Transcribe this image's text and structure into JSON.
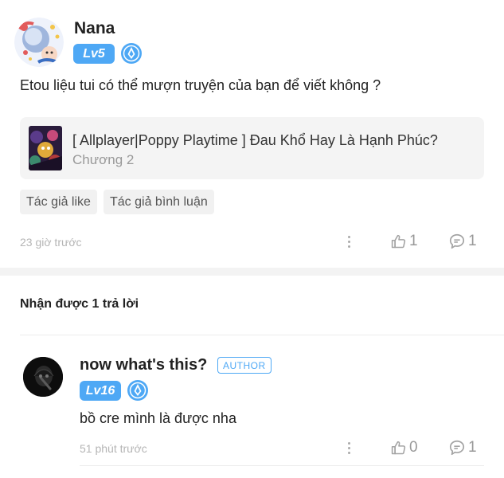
{
  "post": {
    "author_name": "Nana",
    "level": "Lv5",
    "comment": "Etou liệu tui có thể mượn truyện của bạn để viết không ?",
    "story": {
      "title": "[ Allplayer|Poppy Playtime ] Đau Khổ Hay Là Hạnh Phúc?",
      "chapter": "Chương 2"
    },
    "tags": [
      "Tác giả like",
      "Tác giả bình luận"
    ],
    "timestamp": "23 giờ trước",
    "likes": "1",
    "replies": "1"
  },
  "replies_section": {
    "header": "Nhận được 1 trả lời"
  },
  "reply": {
    "author_name": "now what's this?",
    "author_badge": "AUTHOR",
    "level": "Lv16",
    "comment": "bồ cre mình là được nha",
    "timestamp": "51 phút trước",
    "likes": "0",
    "replies": "1"
  },
  "colors": {
    "accent": "#4ea8f5",
    "muted": "#b5b5b5",
    "separator": "#f3f3f3"
  }
}
